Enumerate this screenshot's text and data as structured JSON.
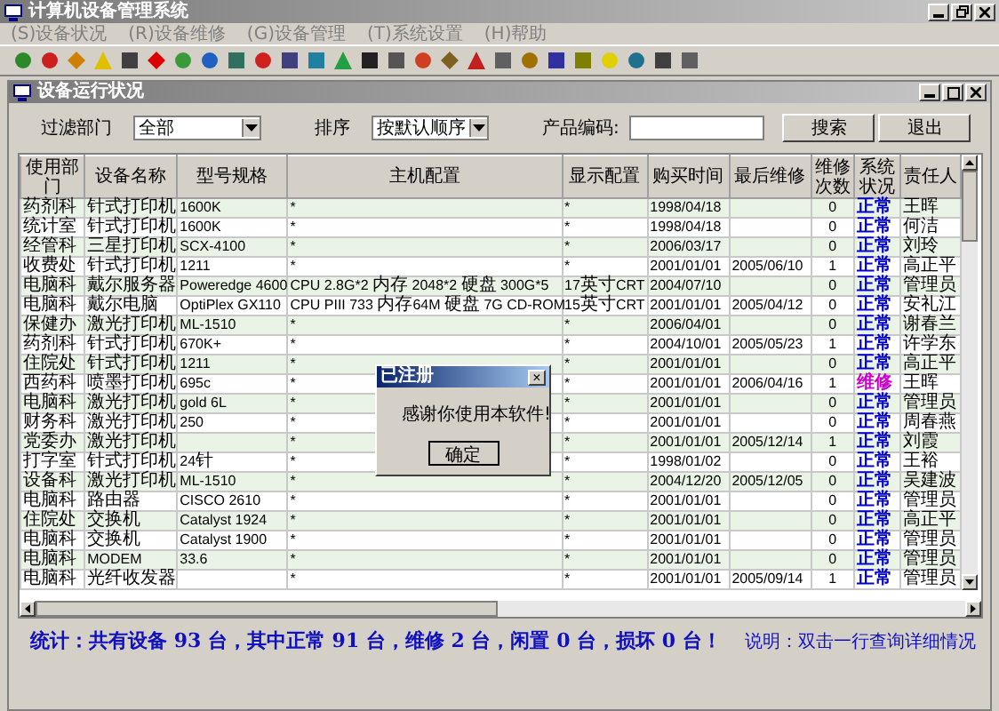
{
  "window": {
    "title": "计算机设备管理系统"
  },
  "menu": [
    {
      "label": "(S)设备状况"
    },
    {
      "label": "(R)设备维修"
    },
    {
      "label": "(G)设备管理"
    },
    {
      "label": "(T)系统设置"
    },
    {
      "label": "(H)帮助"
    }
  ],
  "child_window": {
    "title": "设备运行状况"
  },
  "filter": {
    "department_label": "过滤部门",
    "department_value": "全部",
    "sort_label": "排序",
    "sort_value": "按默认顺序",
    "code_label": "产品编码:",
    "buttons": [
      "搜索",
      "退出"
    ]
  },
  "table": {
    "columns": [
      "使用部门",
      "设备名称",
      "型号规格",
      "主机配置",
      "显示配置",
      "购买时间",
      "最后维修",
      "维修次数",
      "系统状况",
      "责任人"
    ],
    "rows": [
      {
        "cells": [
          "药剂科",
          "针式打印机",
          "1600K",
          "*",
          "*",
          "1998/04/18",
          "",
          "0",
          "正常",
          "王晖"
        ],
        "color": "#0000cc"
      },
      {
        "cells": [
          "统计室",
          "针式打印机",
          "1600K",
          "*",
          "*",
          "1998/04/18",
          "",
          "0",
          "正常",
          "何洁"
        ],
        "color": "#0000cc"
      },
      {
        "cells": [
          "经管科",
          "三星打印机",
          "SCX-4100",
          "*",
          "*",
          "2006/03/17",
          "",
          "0",
          "正常",
          "刘玲"
        ],
        "color": "#0000cc"
      },
      {
        "cells": [
          "收费处",
          "针式打印机",
          "1211",
          "*",
          "*",
          "2001/01/01",
          "2005/06/10",
          "1",
          "正常",
          "高正平"
        ],
        "color": "#0000cc"
      },
      {
        "cells": [
          "电脑科",
          "戴尔服务器",
          "Poweredge 4600",
          "CPU 2.8G*2 内存 2048*2 硬盘 300G*5",
          "17英寸CRT",
          "2004/07/10",
          "",
          "0",
          "正常",
          "管理员"
        ],
        "color": "#0000cc"
      },
      {
        "cells": [
          "电脑科",
          "戴尔电脑",
          "OptiPlex GX110",
          "CPU PIII 733 内存64M 硬盘 7G CD-ROM",
          "15英寸CRT",
          "2001/01/01",
          "2005/04/12",
          "0",
          "正常",
          "安礼江"
        ],
        "color": "#0000cc"
      },
      {
        "cells": [
          "保健办",
          "激光打印机",
          "ML-1510",
          "*",
          "*",
          "2006/04/01",
          "",
          "0",
          "正常",
          "谢春兰"
        ],
        "color": "#0000cc"
      },
      {
        "cells": [
          "药剂科",
          "针式打印机",
          "670K+",
          "*",
          "*",
          "2004/10/01",
          "2005/05/23",
          "1",
          "正常",
          "许学东"
        ],
        "color": "#0000cc"
      },
      {
        "cells": [
          "住院处",
          "针式打印机",
          "1211",
          "*",
          "*",
          "2001/01/01",
          "",
          "0",
          "正常",
          "高正平"
        ],
        "color": "#0000cc"
      },
      {
        "cells": [
          "西药科",
          "喷墨打印机",
          "695c",
          "*",
          "*",
          "2001/01/01",
          "2006/04/16",
          "1",
          "维修",
          "王晖"
        ],
        "color": "#cc00cc"
      },
      {
        "cells": [
          "电脑科",
          "激光打印机",
          "gold 6L",
          "*",
          "*",
          "2001/01/01",
          "",
          "0",
          "正常",
          "管理员"
        ],
        "color": "#0000cc"
      },
      {
        "cells": [
          "财务科",
          "激光打印机",
          "250",
          "*",
          "*",
          "2001/01/01",
          "",
          "0",
          "正常",
          "周春燕"
        ],
        "color": "#0000cc"
      },
      {
        "cells": [
          "党委办",
          "激光打印机",
          "",
          "*",
          "*",
          "2001/01/01",
          "2005/12/14",
          "1",
          "正常",
          "刘霞"
        ],
        "color": "#0000cc"
      },
      {
        "cells": [
          "打字室",
          "针式打印机",
          "24针",
          "*",
          "*",
          "1998/01/02",
          "",
          "0",
          "正常",
          "王裕"
        ],
        "color": "#0000cc"
      },
      {
        "cells": [
          "设备科",
          "激光打印机",
          "ML-1510",
          "*",
          "*",
          "2004/12/20",
          "2005/12/05",
          "0",
          "正常",
          "吴建波"
        ],
        "color": "#0000cc"
      },
      {
        "cells": [
          "电脑科",
          "路由器",
          "CISCO 2610",
          "*",
          "*",
          "2001/01/01",
          "",
          "0",
          "正常",
          "管理员"
        ],
        "color": "#0000cc"
      },
      {
        "cells": [
          "住院处",
          "交换机",
          "Catalyst 1924",
          "*",
          "*",
          "2001/01/01",
          "",
          "0",
          "正常",
          "高正平"
        ],
        "color": "#0000cc"
      },
      {
        "cells": [
          "电脑科",
          "交换机",
          "Catalyst 1900",
          "*",
          "*",
          "2001/01/01",
          "",
          "0",
          "正常",
          "管理员"
        ],
        "color": "#0000cc"
      },
      {
        "cells": [
          "电脑科",
          "MODEM",
          "33.6",
          "*",
          "*",
          "2001/01/01",
          "",
          "0",
          "正常",
          "管理员"
        ],
        "color": "#0000cc"
      },
      {
        "cells": [
          "电脑科",
          "光纤收发器",
          "",
          "*",
          "*",
          "2001/01/01",
          "2005/09/14",
          "1",
          "正常",
          "管理员"
        ],
        "color": "#0000cc"
      }
    ]
  },
  "summary": "统计：共有设备 93 台，其中正常 91 台，维修 2 台，闲置 0 台，损坏 0 台！",
  "note": "说明：双击一行查询详细情况",
  "dialog": {
    "title": "已注册",
    "close": "×",
    "message": "感谢你使用本软件!",
    "button": "确定"
  }
}
